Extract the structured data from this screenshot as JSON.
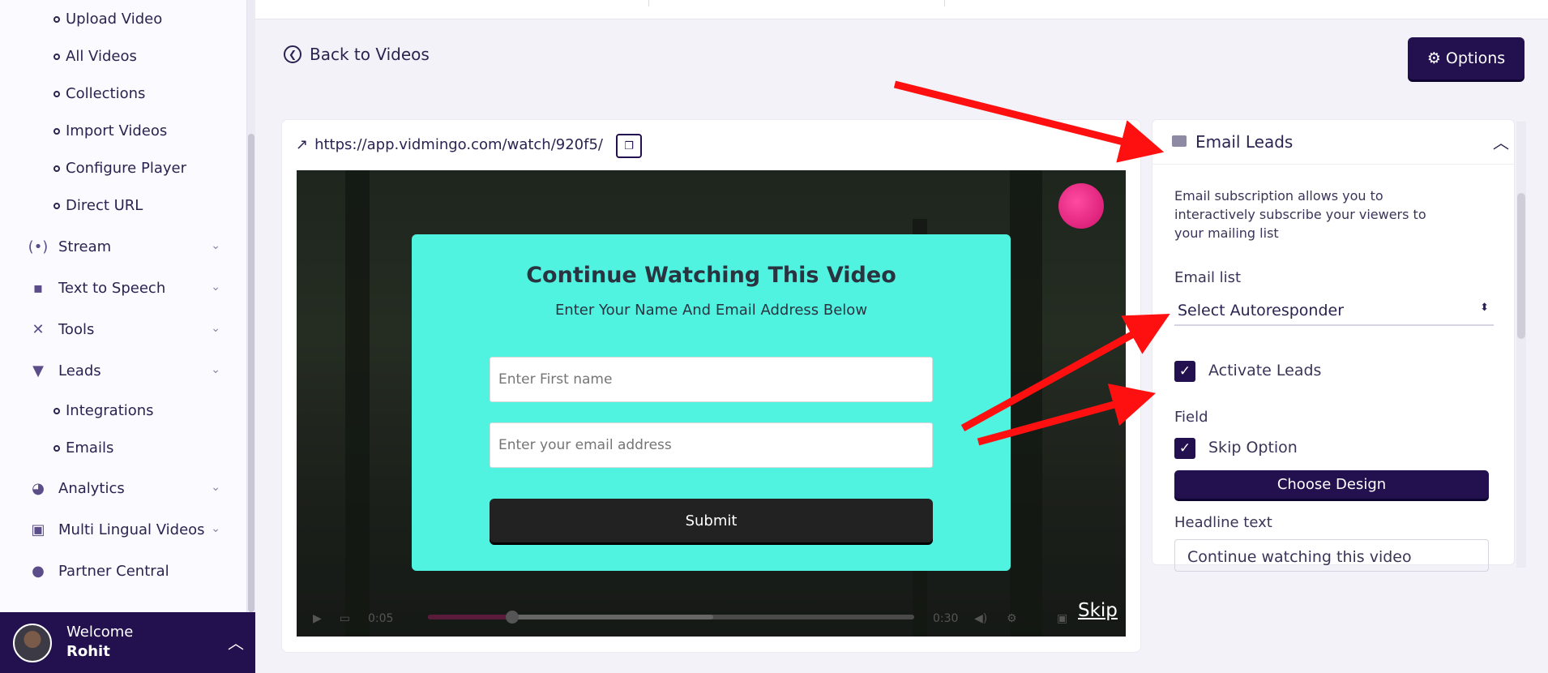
{
  "sidebar": {
    "sub_items_top": [
      "Upload Video",
      "All Videos",
      "Collections",
      "Import Videos",
      "Configure Player",
      "Direct URL"
    ],
    "menu": [
      {
        "label": "Stream",
        "icon": "stream-icon"
      },
      {
        "label": "Text to Speech",
        "icon": "chat-icon"
      },
      {
        "label": "Tools",
        "icon": "tools-icon"
      },
      {
        "label": "Leads",
        "icon": "filter-icon"
      }
    ],
    "leads_sub_items": [
      "Integrations",
      "Emails"
    ],
    "menu_bottom": [
      {
        "label": "Analytics",
        "icon": "pie-chart-icon"
      },
      {
        "label": "Multi Lingual Videos",
        "icon": "language-icon"
      },
      {
        "label": "Partner Central",
        "icon": "users-icon"
      }
    ],
    "welcome": {
      "greeting": "Welcome",
      "user": "Rohit"
    }
  },
  "header": {
    "back_label": "Back to Videos",
    "options_label": "Options"
  },
  "video": {
    "url": "https://app.vidmingo.com/watch/920f5/",
    "time_current": "0:05",
    "time_total": "0:30",
    "progress": 0.17,
    "skip_label": "Skip"
  },
  "overlay": {
    "title": "Continue Watching This Video",
    "subtitle": "Enter Your Name And Email Address Below",
    "first_name_placeholder": "Enter First name",
    "email_placeholder": "Enter your email address",
    "submit_label": "Submit",
    "bg_color": "#50f3e0"
  },
  "panel": {
    "title": "Email Leads",
    "description": "Email subscription allows you to interactively subscribe your viewers to your mailing list",
    "email_list_label": "Email list",
    "email_list_value": "Select Autoresponder",
    "activate_leads_label": "Activate Leads",
    "field_label": "Field",
    "skip_option_label": "Skip Option",
    "choose_design_label": "Choose Design",
    "headline_label": "Headline text",
    "headline_value": "Continue watching this video"
  },
  "colors": {
    "brand": "#23114f",
    "annotation_arrow": "#ff1010"
  }
}
